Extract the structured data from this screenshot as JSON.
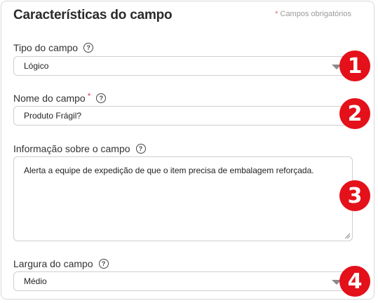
{
  "panel": {
    "title": "Características do campo",
    "required_note_star": "*",
    "required_note": "Campos obrigatórios"
  },
  "fields": {
    "type": {
      "label": "Tipo do campo",
      "value": "Lógico"
    },
    "name": {
      "label": "Nome do campo",
      "required_mark": "*",
      "value": "Produto Frágil?"
    },
    "info": {
      "label": "Informação sobre o campo",
      "value": "Alerta a equipe de expedição de que o item precisa de embalagem reforçada."
    },
    "width": {
      "label": "Largura do campo",
      "value": "Médio"
    }
  },
  "help_glyph": "?",
  "badges": [
    "1",
    "2",
    "3",
    "4"
  ],
  "colors": {
    "badge": "#e4101a",
    "required": "#e0445a"
  }
}
